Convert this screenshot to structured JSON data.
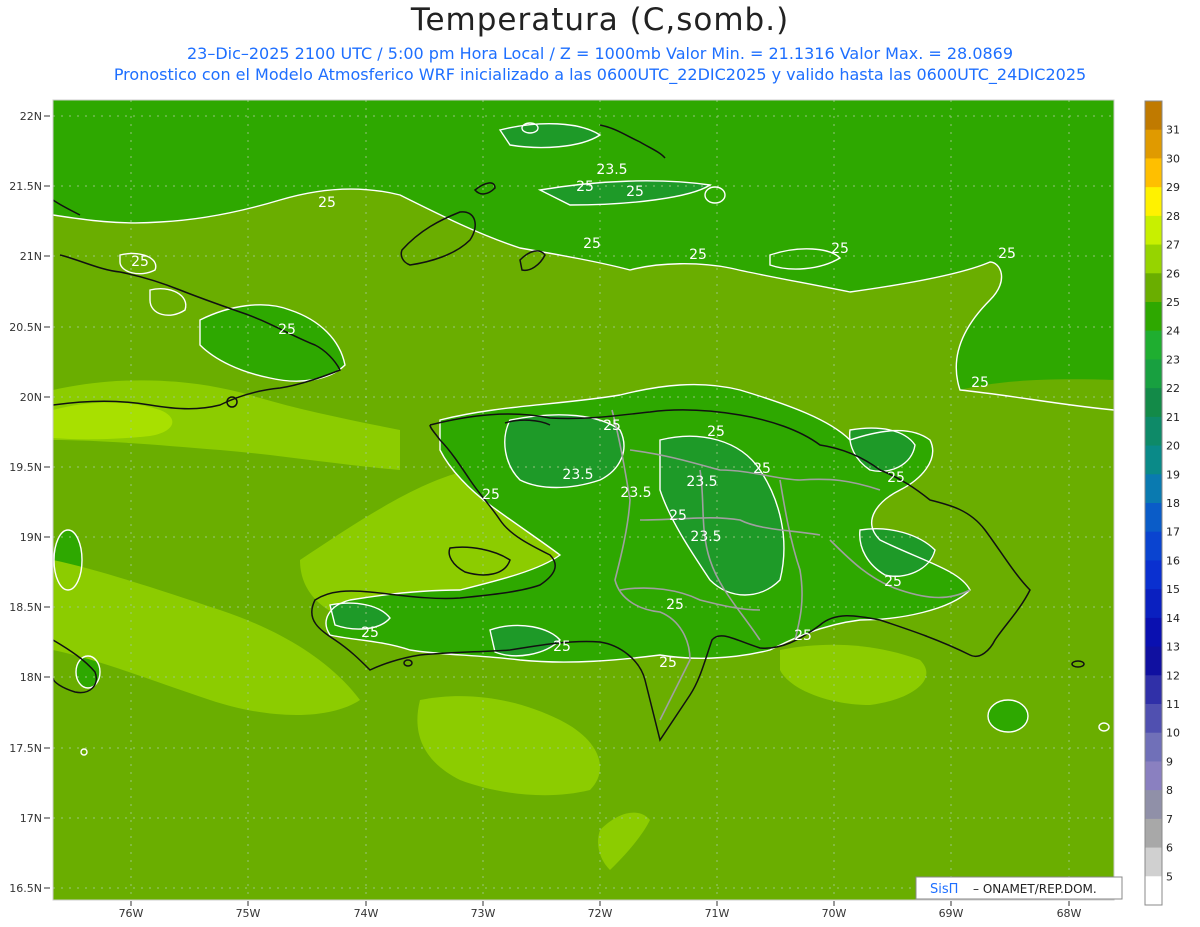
{
  "header": {
    "title": "Temperatura (C,somb.)",
    "subtitle_line1": "23–Dic–2025  2100 UTC / 5:00 pm Hora Local / Z = 1000mb    Valor Min. = 21.1316  Valor Max. = 28.0869",
    "subtitle_line2": "Pronostico con el Modelo Atmosferico WRF inicializado a las 0600UTC_22DIC2025 y valido hasta las  0600UTC_24DIC2025"
  },
  "map": {
    "lat_labels": [
      "22N",
      "21.5N",
      "21N",
      "20.5N",
      "20N",
      "19.5N",
      "19N",
      "18.5N",
      "18N",
      "17.5N",
      "17N",
      "16.5N"
    ],
    "lon_labels": [
      "76W",
      "75W",
      "74W",
      "73W",
      "72W",
      "71W",
      "70W",
      "69W",
      "68W"
    ],
    "contour_labels": [
      "25",
      "25",
      "25",
      "25",
      "25",
      "25",
      "25",
      "25",
      "25",
      "25",
      "25",
      "25",
      "25",
      "25",
      "25",
      "25",
      "25",
      "25",
      "25",
      "23.5",
      "23.5",
      "23.5",
      "23.5",
      "23.5"
    ],
    "credit": {
      "brand": "SisΠ",
      "text": "– ONAMET/REP.DOM."
    }
  },
  "colorbar": {
    "labels": [
      "31",
      "30",
      "29",
      "28",
      "27",
      "26",
      "25",
      "24",
      "23",
      "22",
      "21",
      "20",
      "19",
      "18",
      "17",
      "16",
      "15",
      "14",
      "13",
      "12",
      "11",
      "10",
      "9",
      "8",
      "7",
      "6",
      "5"
    ],
    "colors": [
      "#c07a00",
      "#e09a00",
      "#ffbf00",
      "#fff200",
      "#c8f000",
      "#96d400",
      "#6aae00",
      "#2ea800",
      "#1fae30",
      "#18a040",
      "#138a48",
      "#0e8a68",
      "#0a8a88",
      "#0a7ab0",
      "#0a5cc8",
      "#0a44d0",
      "#0a30d0",
      "#0a20c0",
      "#0a10b0",
      "#1010a0",
      "#3030a8",
      "#5050b0",
      "#7070b8",
      "#8a80c0",
      "#9090a8",
      "#a8a8a8",
      "#d0d0d0",
      "#ffffff"
    ]
  },
  "colors": {
    "sea_24_25": "#2ea800",
    "land_25_26": "#6aae00",
    "warm_26_27": "#8ccc00",
    "hot_27_28": "#a8e000",
    "cool_23_24": "#1e9a28",
    "coast": "#111111",
    "contour": "#ffffff",
    "border": "#a0a0a0"
  }
}
